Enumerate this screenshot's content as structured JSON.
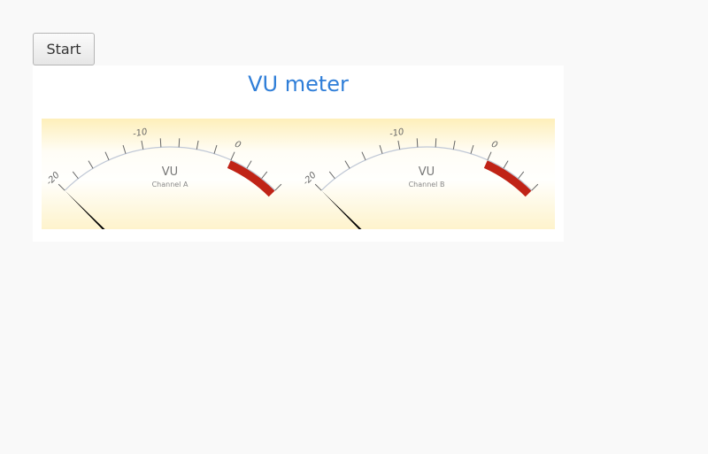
{
  "toolbar": {
    "start_label": "Start"
  },
  "chart_data": {
    "type": "gauge",
    "title": "VU meter",
    "gauges": [
      {
        "name": "Channel A",
        "label": "VU",
        "subtitle": "Channel A",
        "min": -20,
        "max": 6,
        "value": -20,
        "tick_labels": [
          "-20",
          "-10",
          "0"
        ],
        "red_band": [
          0,
          6
        ]
      },
      {
        "name": "Channel B",
        "label": "VU",
        "subtitle": "Channel B",
        "min": -20,
        "max": 6,
        "value": -20,
        "tick_labels": [
          "-20",
          "-10",
          "0"
        ],
        "red_band": [
          0,
          6
        ]
      }
    ],
    "colors": {
      "title": "#2f7ed8",
      "red_band": "#c02316",
      "arc": "#c0c8d6",
      "needle": "#000000"
    }
  }
}
